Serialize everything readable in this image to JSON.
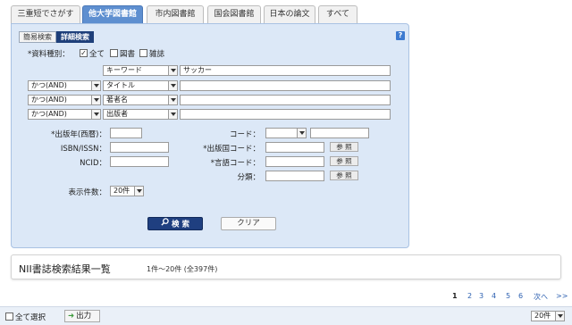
{
  "tabs": [
    {
      "label": "三重短でさがす",
      "active": false
    },
    {
      "label": "他大学図書館",
      "active": true
    },
    {
      "label": "市内図書館",
      "active": false
    },
    {
      "label": "国会図書館",
      "active": false
    },
    {
      "label": "日本の論文",
      "active": false
    },
    {
      "label": "すべて",
      "active": false
    }
  ],
  "search_mode": {
    "simple": "簡易検索",
    "advanced": "詳細検索"
  },
  "help_icon": "?",
  "material_type": {
    "label": "*資料種別：",
    "options": [
      {
        "label": "全て",
        "checked": true
      },
      {
        "label": "図書",
        "checked": false
      },
      {
        "label": "雑誌",
        "checked": false
      }
    ]
  },
  "keyword_rows": [
    {
      "operator": "",
      "field": "キーワード",
      "value": "サッカー"
    },
    {
      "operator": "かつ(AND)",
      "field": "タイトル",
      "value": ""
    },
    {
      "operator": "かつ(AND)",
      "field": "著者名",
      "value": ""
    },
    {
      "operator": "かつ(AND)",
      "field": "出版者",
      "value": ""
    }
  ],
  "fields": {
    "pub_year": "*出版年(西暦)：",
    "isbn": "ISBN/ISSN：",
    "ncid": "NCID：",
    "code": "コード：",
    "pub_country": "*出版国コード：",
    "language": "*言語コード：",
    "classification": "分類：",
    "reference_btn": "参 照",
    "display_count_label": "表示件数：",
    "display_count_value": "20件"
  },
  "buttons": {
    "search": "検 索",
    "clear": "クリア"
  },
  "results": {
    "title": "NII書誌検索結果一覧",
    "count": "1件～20件 (全397件)"
  },
  "pagination": {
    "pages": [
      "1",
      "2",
      "3",
      "4",
      "5",
      "6"
    ],
    "current": "1",
    "next": "次へ",
    "last": ">>"
  },
  "bottom": {
    "select_all": "全て選択",
    "output": "出力",
    "per_page": "20件"
  }
}
